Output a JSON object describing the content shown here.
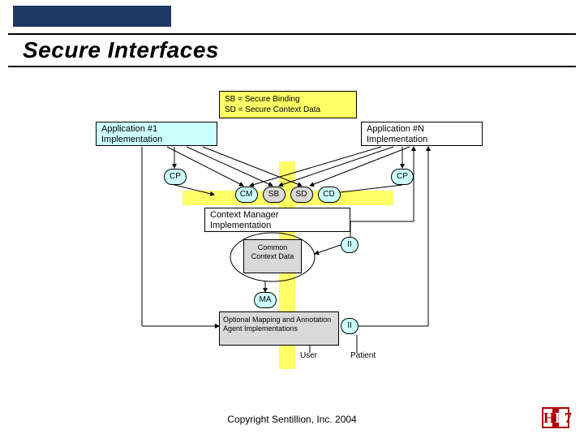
{
  "title": "Secure Interfaces",
  "legend": {
    "line1": "SB = Secure Binding",
    "line2": "SD = Secure Context Data"
  },
  "app1": {
    "l1": "Application #1",
    "l2": "Implementation"
  },
  "appn": {
    "l1": "Application #N",
    "l2": "Implementation"
  },
  "cp": "CP",
  "nodes": {
    "cm": "CM",
    "sb": "SB",
    "sd": "SD",
    "cd": "CD"
  },
  "ctx_impl": {
    "l1": "Context Manager",
    "l2": "Implementation"
  },
  "ccd": "Common Context Data",
  "ii": "II",
  "ma": "MA",
  "map_box": "Optional Mapping and Annotation Agent Implementations",
  "user": "User",
  "patient": "Patient",
  "copyright": "Copyright Sentillion, Inc. 2004",
  "logo": {
    "a": "H",
    "b": "L",
    "c": "7"
  }
}
